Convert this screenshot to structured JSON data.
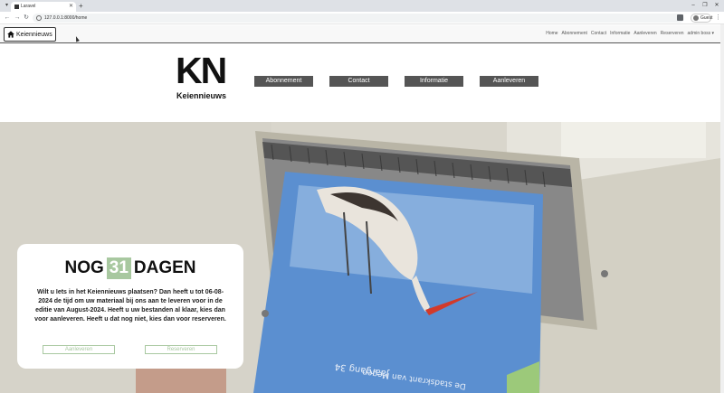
{
  "browser": {
    "tab_title": "Laravel",
    "url": "127.0.0.1:8000/home",
    "profile_label": "Guest",
    "icons": {
      "tab_menu": "chevron-down-icon",
      "new_tab": "plus-icon",
      "back": "arrow-left-icon",
      "forward": "arrow-right-icon",
      "reload": "reload-icon",
      "menu": "kebab-icon"
    }
  },
  "nav": {
    "brand_label": "Keiennieuws",
    "links": [
      "Home",
      "Abonnement",
      "Contact",
      "Informatie",
      "Aanleveren",
      "Reserveren",
      "admin boss ▾"
    ]
  },
  "header": {
    "logo_initials": "KN",
    "logo_name": "Keiennieuws",
    "buttons": [
      "Abonnement",
      "Contact",
      "Informatie",
      "Aanleveren"
    ]
  },
  "countdown": {
    "prefix": "NOG",
    "days": "31",
    "suffix": "DAGEN",
    "message": "Wilt u Iets in het Keiennieuws plaatsen? Dan heeft u tot 06-08-2024 de tijd om uw materiaal bij ons aan te leveren voor in de editie van August-2024. Heeft u uw bestanden al klaar, kies dan voor aanleveren. Heeft u dat nog niet, kies dan voor reserveren.",
    "btn_aanleveren": "Aanleveren",
    "btn_reserveren": "Reserveren"
  },
  "photo": {
    "magazine_lines": [
      "Jaargang 34",
      "De stadskrant van Megen"
    ]
  },
  "colors": {
    "accent_green": "#a8c8a0",
    "button_gray": "#555555"
  }
}
